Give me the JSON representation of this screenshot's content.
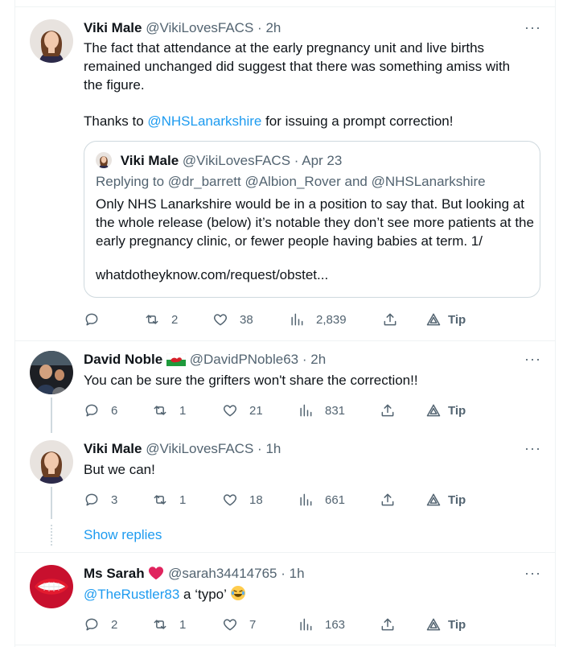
{
  "tweets": [
    {
      "name": "Viki Male",
      "handle": "@VikiLovesFACS",
      "time": "2h",
      "text_lines": [
        "The fact that attendance at the early pregnancy unit and live births",
        "remained unchanged did suggest that there was something amiss with",
        "the figure."
      ],
      "thanks_prefix": "Thanks to ",
      "thanks_mention": "@NHSLanarkshire",
      "thanks_suffix": " for issuing a prompt correction!",
      "quote": {
        "name": "Viki Male",
        "handle": "@VikiLovesFACS",
        "time": "Apr 23",
        "replying": "Replying to @dr_barrett @Albion_Rover and @NHSLanarkshire",
        "text": "Only NHS Lanarkshire would be in a position to say that. But looking at the whole release (below) it’s notable they don’t see more patients at the early pregnancy clinic, or fewer people having babies at term. 1/",
        "link": "whatdotheyknow.com/request/obstet..."
      },
      "replies": "",
      "retweets": "2",
      "likes": "38",
      "views": "2,839",
      "tip": "Tip"
    },
    {
      "name": "David Noble",
      "handle": "@DavidPNoble63",
      "time": "2h",
      "text": "You can be sure the grifters won't share the correction!!",
      "replies": "6",
      "retweets": "1",
      "likes": "21",
      "views": "831",
      "tip": "Tip"
    },
    {
      "name": "Viki Male",
      "handle": "@VikiLovesFACS",
      "time": "1h",
      "text": "But we can!",
      "replies": "3",
      "retweets": "1",
      "likes": "18",
      "views": "661",
      "tip": "Tip"
    },
    {
      "name": "Ms Sarah",
      "handle": "@sarah34414765",
      "time": "1h",
      "mention": "@TheRustler83",
      "text": " a ‘typo’",
      "replies": "2",
      "retweets": "1",
      "likes": "7",
      "views": "163",
      "tip": "Tip"
    }
  ],
  "show_replies": "Show replies",
  "separator": "·",
  "more": "···",
  "colors": {
    "link": "#1d9bf0",
    "muted": "#536471",
    "border": "#eff3f4",
    "heart": "#e0245e"
  },
  "icons": [
    "reply-icon",
    "retweet-icon",
    "like-icon",
    "views-icon",
    "share-icon",
    "tip-icon",
    "more-icon",
    "wales-flag-icon",
    "red-heart-icon",
    "laughing-emoji-icon"
  ]
}
